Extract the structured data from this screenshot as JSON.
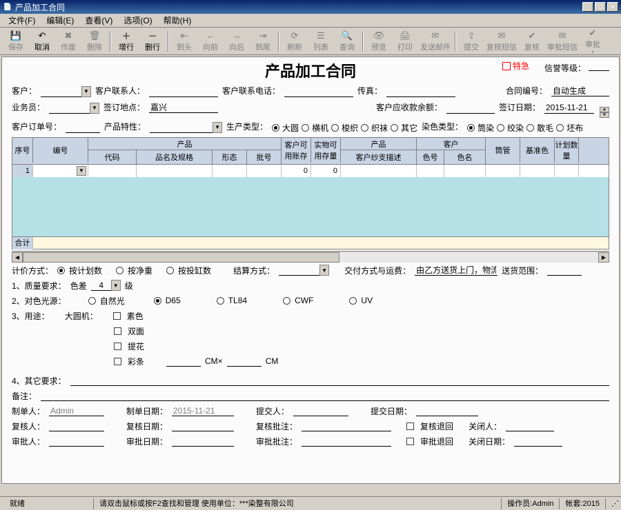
{
  "window": {
    "title": "产品加工合同"
  },
  "menu": {
    "file": "文件(F)",
    "edit": "编辑(E)",
    "view": "查看(V)",
    "option": "选项(O)",
    "help": "帮助(H)"
  },
  "toolbar": {
    "save": "保存",
    "cancel": "取消",
    "void": "作废",
    "delete": "删除",
    "addrow": "增行",
    "delrow": "删行",
    "first": "到头",
    "prev": "向前",
    "next": "向后",
    "last": "到尾",
    "refresh": "刷新",
    "list": "列表",
    "query": "查询",
    "preview": "预览",
    "print": "打印",
    "sendmail": "发送邮件",
    "submit": "提交",
    "reviewmsg": "复核短信",
    "review": "复核",
    "approvemsg": "审批短信",
    "approve": "审批"
  },
  "form": {
    "title": "产品加工合同",
    "urgent": "特急",
    "credit_label": "信誉等级：",
    "customer": "客户：",
    "contact": "客户联系人：",
    "phone": "客户联系电话：",
    "fax": "传真：",
    "contract_no_label": "合同编号：",
    "contract_no": "自动生成",
    "sales": "业务员：",
    "sign_place_label": "签订地点：",
    "sign_place": "嘉兴",
    "receivable": "客户应收款余额：",
    "sign_date_label": "签订日期：",
    "sign_date": "2015-11-21",
    "cust_order": "客户订单号：",
    "prod_char": "产品特性：",
    "prod_type_label": "生产类型：",
    "prod_types": [
      "大圆",
      "横机",
      "梭织",
      "织袜",
      "其它"
    ],
    "prod_type_sel": 0,
    "dye_type_label": "染色类型：",
    "dye_types": [
      "筒染",
      "绞染",
      "散毛",
      "坯布"
    ],
    "dye_type_sel": 0
  },
  "grid": {
    "h1": {
      "seq": "序号",
      "num": "编号",
      "product": "产品",
      "bal": "客户可用账存",
      "stock": "实物可用存量",
      "prod2": "产品",
      "cust": "客户",
      "tube": "筒管",
      "base": "基准色",
      "plan": "计划数量"
    },
    "h2": {
      "code": "代码",
      "name": "品名及规格",
      "form": "形态",
      "lot": "批号",
      "yarn": "客户纱支描述",
      "cno": "色号",
      "cname": "色名"
    },
    "row1": {
      "seq": "1",
      "bal": "0",
      "stock": "0"
    },
    "sum": "合计"
  },
  "lower": {
    "pricing_label": "计价方式：",
    "pricing_opts": [
      "按计划数",
      "按净重",
      "按投缸数"
    ],
    "pricing_sel": 0,
    "settle_label": "结算方式：",
    "delivery_label": "交付方式与运费：",
    "delivery_val": "由乙方送货上门，物流",
    "delivery_range": "送货范围：",
    "quality": "1、质量要求：",
    "colordiff": "色差",
    "colordiff_val": "4",
    "grade": "级",
    "light": "2、对色光源：",
    "light_opts": [
      "自然光",
      "D65",
      "TL84",
      "CWF",
      "UV"
    ],
    "light_sel": 1,
    "use": "3、用途：",
    "machine": "大圆机：",
    "use_opts": [
      "素色",
      "双面",
      "提花",
      "彩条"
    ],
    "cm": "CM×",
    "cm2": "CM",
    "other": "4、其它要求：",
    "remark": "备注：",
    "maker_label": "制单人：",
    "maker": "Admin",
    "make_date_label": "制单日期：",
    "make_date": "2015-11-21",
    "submitter": "提交人：",
    "submit_date": "提交日期：",
    "reviewer": "复核人：",
    "review_date": "复核日期：",
    "review_note": "复核批注：",
    "review_return": "复核退回",
    "closer": "关闭人：",
    "approver": "审批人：",
    "approve_date": "审批日期：",
    "approve_note": "审批批注：",
    "approve_return": "审批退回",
    "close_date": "关闭日期："
  },
  "status": {
    "ready": "就绪",
    "hint": "请双击鼠标或按F2查找和管理 使用单位：***染整有限公司",
    "operator": "操作员:Admin",
    "account": "帐套:2015"
  }
}
